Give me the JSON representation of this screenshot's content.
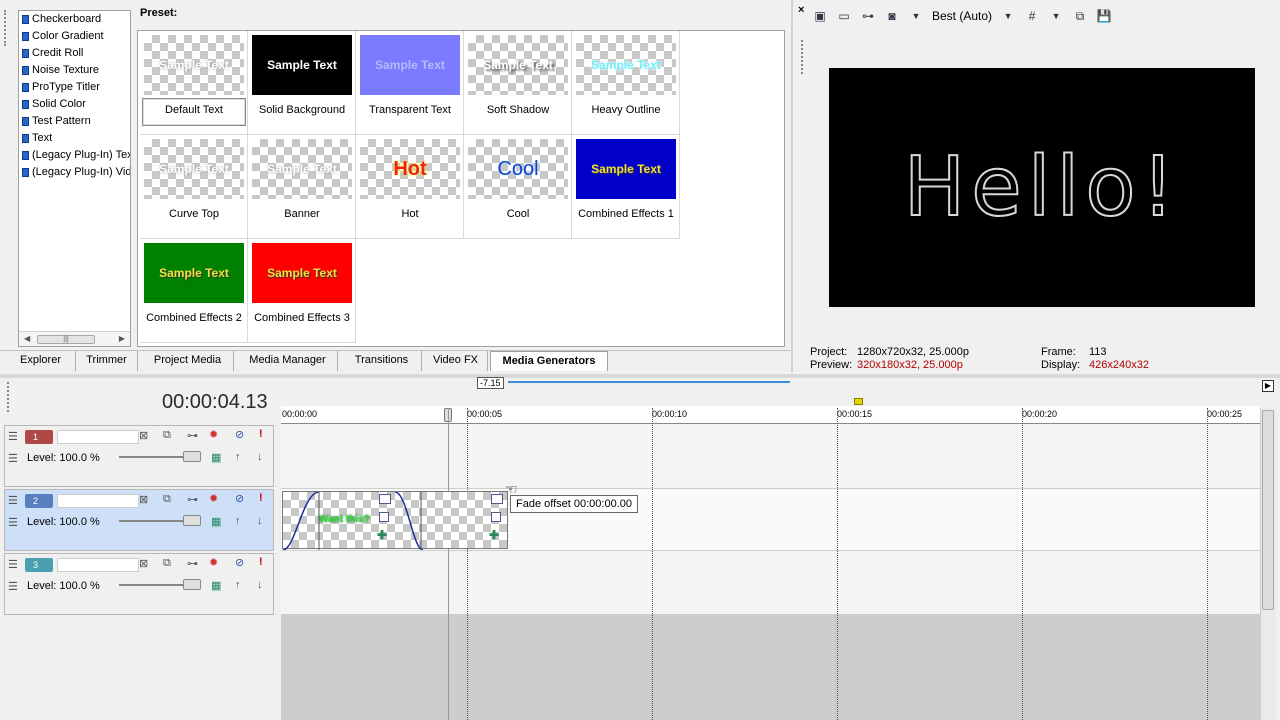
{
  "generators": [
    "Checkerboard",
    "Color Gradient",
    "Credit Roll",
    "Noise Texture",
    "ProType Titler",
    "Solid Color",
    "Test Pattern",
    "Text",
    "(Legacy Plug-In) Text",
    "(Legacy Plug-In) Video"
  ],
  "preset_label": "Preset:",
  "presets": [
    {
      "name": "Default Text",
      "thumb_text": "Sample Text"
    },
    {
      "name": "Solid Background",
      "thumb_text": "Sample Text"
    },
    {
      "name": "Transparent Text",
      "thumb_text": "Sample Text"
    },
    {
      "name": "Soft Shadow",
      "thumb_text": "Sample Text"
    },
    {
      "name": "Heavy Outline",
      "thumb_text": "Sample Text"
    },
    {
      "name": "Curve Top",
      "thumb_text": "Sample Text"
    },
    {
      "name": "Banner",
      "thumb_text": "Sample Text"
    },
    {
      "name": "Hot",
      "thumb_text": "Hot"
    },
    {
      "name": "Cool",
      "thumb_text": "Cool"
    },
    {
      "name": "Combined Effects 1",
      "thumb_text": "Sample Text"
    },
    {
      "name": "Combined Effects 2",
      "thumb_text": "Sample Text"
    },
    {
      "name": "Combined Effects 3",
      "thumb_text": "Sample Text"
    }
  ],
  "tabs": [
    "Explorer",
    "Trimmer",
    "Project Media",
    "Media Manager",
    "Transitions",
    "Video FX",
    "Media Generators"
  ],
  "active_tab": "Media Generators",
  "preview": {
    "quality": "Best (Auto)",
    "display_text": "Hello!",
    "project_label": "Project:",
    "project_value": "1280x720x32, 25.000p",
    "preview_label": "Preview:",
    "preview_value": "320x180x32, 25.000p",
    "frame_label": "Frame:",
    "frame_value": "113",
    "display_label": "Display:",
    "display_value": "426x240x32"
  },
  "timeline": {
    "timecode": "00:00:04.13",
    "loop_marker": "-7.15",
    "ruler": [
      "00:00:00",
      "00:00:05",
      "00:00:10",
      "00:00:15",
      "00:00:20",
      "00:00:25"
    ],
    "tracks": [
      {
        "num": "1",
        "level": "Level: 100.0 %",
        "color": "#b04848"
      },
      {
        "num": "2",
        "level": "Level: 100.0 %",
        "color": "#5a7fbf"
      },
      {
        "num": "3",
        "level": "Level: 100.0 %",
        "color": "#4aa0b0"
      }
    ],
    "clip_text": "Want this?",
    "tooltip": "Fade offset 00:00:00.00"
  }
}
